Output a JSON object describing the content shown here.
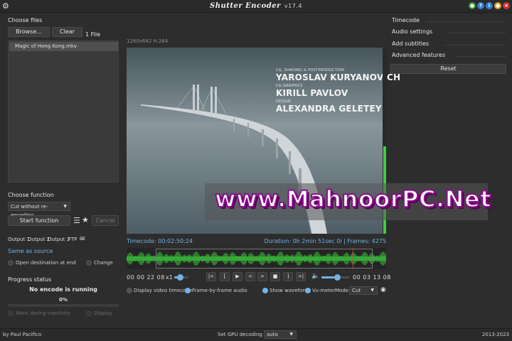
{
  "app": {
    "name": "Shutter Encoder",
    "version": "v17.4"
  },
  "left": {
    "choose_files_label": "Choose files",
    "browse_label": "Browse...",
    "clear_label": "Clear",
    "file_count": "1 File",
    "files": [
      "Magic of Hong Kong.mkv"
    ],
    "choose_function_label": "Choose function",
    "function_value": "Cut without re-encoding",
    "start_label": "Start function",
    "cancel_label": "Cancel",
    "outputs": [
      "Output 1",
      "Output 2",
      "Output 3",
      "FTP"
    ],
    "same_as_source": "Same as source",
    "open_destination": "Open destination at end",
    "change_label": "Change",
    "progress_label": "Progress status",
    "encode_status": "No encode is running",
    "progress_percent": "0%",
    "progress_value": 0,
    "work_inactivity": "Work during inactivity",
    "display_label": "Display"
  },
  "player": {
    "resolution": "1280x682 H.264",
    "credits": [
      {
        "role": "CG, SHADING & POSTPRODUCTION",
        "name": "YAROSLAV KURYANOVICH"
      },
      {
        "role": "CG GRAPHICS",
        "name": "KIRILL PAVLOV"
      },
      {
        "role": "DESIGN",
        "name": "ALEXANDRA GELETEY"
      }
    ],
    "timecode": "Timecode: 00:02:50:24",
    "duration": "Duration: 0h 2min 51sec 0i | Frames: 4275",
    "in_time": "00 00 22 08",
    "out_time": "00 03 13 08",
    "speed": "x1",
    "speed_level": 0.4,
    "volume_level": 0.55,
    "vu_level": 0.47,
    "playhead_fraction": 0.87,
    "buttons": [
      "|<",
      "[",
      "▶",
      "<",
      ">",
      "■",
      "]",
      ">|"
    ],
    "display_video_timecode": "Display video timecode",
    "frame_by_frame_audio": "Frame-by-frame audio",
    "show_waveform": "Show waveform",
    "vu_meter": "Vu-meter",
    "mode_label": "Mode:",
    "mode_value": "Cut",
    "accent_color": "#6fb3e8",
    "wave_color": "#3dd33d"
  },
  "watermark": "www.MahnoorPC.Net",
  "right": {
    "items": [
      "Timecode",
      "Audio settings",
      "Add subtitles",
      "Advanced features"
    ],
    "reset_label": "Reset"
  },
  "status": {
    "author": "by Paul Pacifico",
    "gpu_label": "Set GPU decoding to:",
    "gpu_value": "auto",
    "years": "2013-2023"
  }
}
